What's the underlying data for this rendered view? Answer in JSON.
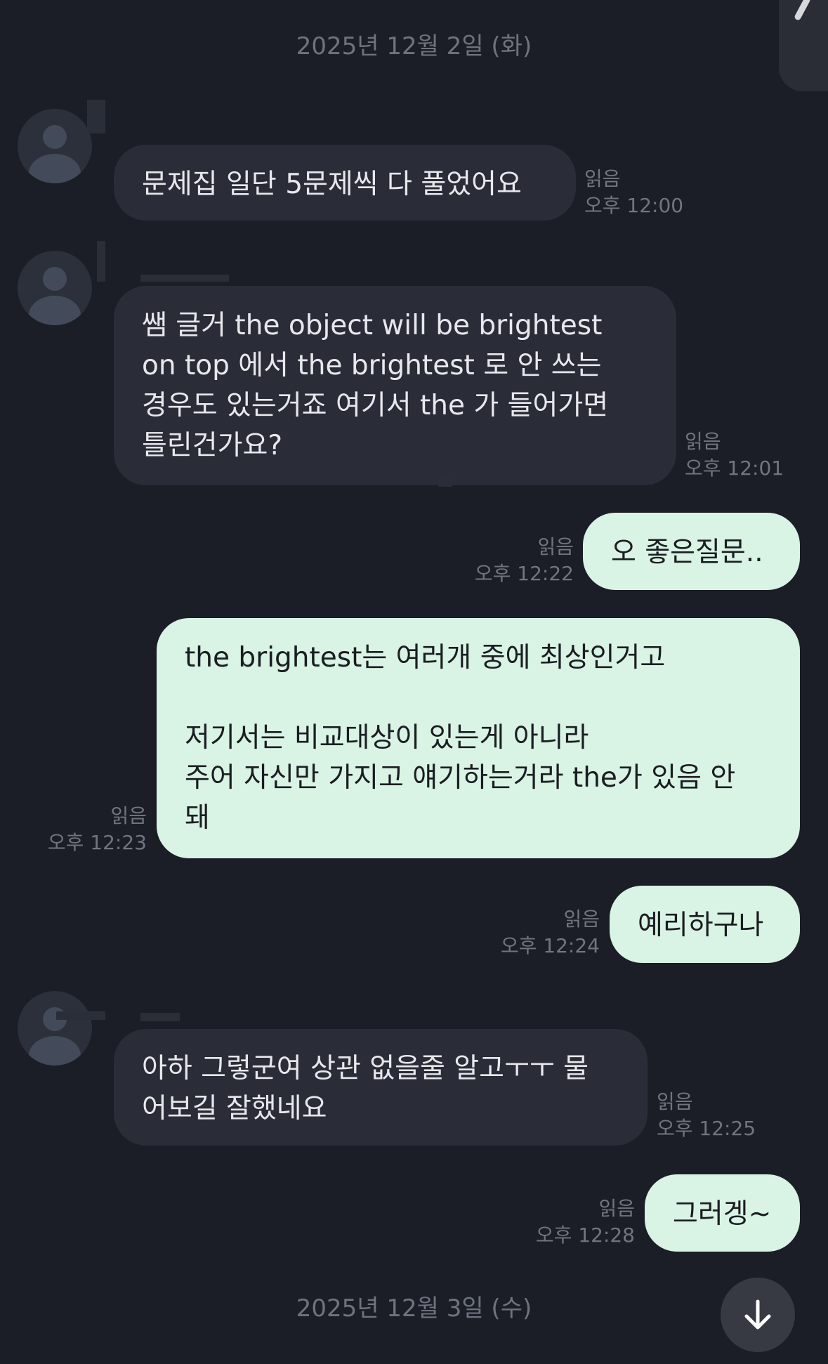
{
  "dates": [
    "2025년 12월 2일 (화)",
    "2025년 12월 3일 (수)"
  ],
  "messages": [
    {
      "dir": "in",
      "text": "문제집 일단 5문제씩 다 풀었어요",
      "read": "읽음",
      "time": "오후 12:00"
    },
    {
      "dir": "in",
      "text": "쌤 글거 the object will be brightest\non top 에서 the brightest 로 안 쓰는\n경우도 있는거죠 여기서 the 가 들어가면\n틀린건가요?",
      "read": "읽음",
      "time": "오후 12:01"
    },
    {
      "dir": "out",
      "text": "오 좋은질문..",
      "read": "읽음",
      "time": "오후 12:22"
    },
    {
      "dir": "out",
      "text": "the brightest는 여러개 중에 최상인거고\n\n저기서는 비교대상이 있는게 아니라\n주어 자신만 가지고 얘기하는거라 the가 있음 안\n돼",
      "read": "읽음",
      "time": "오후 12:23"
    },
    {
      "dir": "out",
      "text": "예리하구나",
      "read": "읽음",
      "time": "오후 12:24"
    },
    {
      "dir": "in",
      "text": "아하 그렇군여 상관 없을줄 알고ㅜㅜ 물\n어보길 잘했네요",
      "read": "읽음",
      "time": "오후 12:25"
    },
    {
      "dir": "out",
      "text": "그러겡~",
      "read": "읽음",
      "time": "오후 12:28"
    }
  ],
  "icons": {
    "avatar": "person-icon",
    "scroll": "arrow-down-icon",
    "corner": "partial-panel"
  },
  "colors": {
    "background": "#1b1e26",
    "incoming_bubble": "#2a2d38",
    "outgoing_bubble": "#d9f3e4",
    "meta_text": "#71757f"
  }
}
